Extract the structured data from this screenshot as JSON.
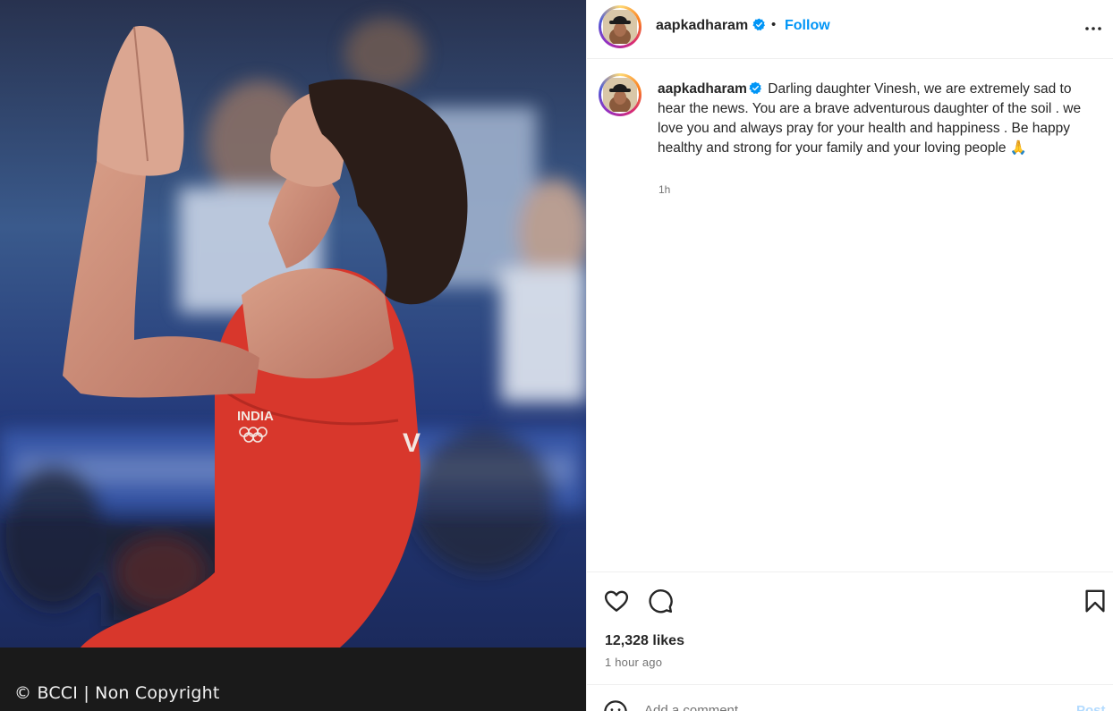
{
  "media": {
    "credit": "© BCCI | Non Copyright",
    "jersey_text": "INDIA"
  },
  "header": {
    "username": "aapkadharam",
    "separator": "•",
    "follow_label": "Follow",
    "more_icon": "more-options-icon"
  },
  "caption": {
    "username": "aapkadharam",
    "text": "Darling daughter Vinesh, we are extremely sad to hear the news. You are a brave adventurous daughter of the soil . we love you and always pray for your health and happiness . Be happy healthy and strong for your family and your loving people 🙏",
    "time": "1h"
  },
  "actions": {
    "like_icon": "heart-icon",
    "comment_icon": "comment-icon",
    "save_icon": "bookmark-icon",
    "likes": "12,328 likes",
    "posted": "1 hour ago"
  },
  "add_comment": {
    "placeholder": "Add a comment…",
    "post_label": "Post"
  },
  "colors": {
    "accent": "#0095f6",
    "verified": "#0095f6",
    "muted": "#737373",
    "text": "#262626"
  }
}
